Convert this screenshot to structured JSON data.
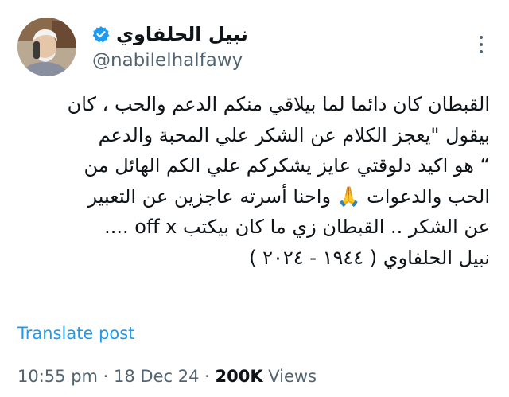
{
  "author": {
    "display_name": "نبيل الحلفاوي",
    "handle": "@nabilelhalfawy",
    "verified": true,
    "avatar_icon": "profile-photo"
  },
  "post": {
    "lines": [
      "القبطان كان دائما لما بيلاقي منكم الدعم والحب ، كان",
      "بيقول \"يعجز الكلام عن الشكر علي المحبة والدعم",
      "“ هو اكيد دلوقتي عايز يشكركم علي الكم الهائل من",
      "الحب والدعوات 🙏 واحنا أسرته عاجزين عن التعبير",
      "عن الشكر .. القبطان زي ما كان بيكتب off x ....",
      "نبيل الحلفاوي ( ١٩٤٤ - ٢٠٢٤ )"
    ]
  },
  "translate_label": "Translate post",
  "meta": {
    "time": "10:55 pm",
    "separator": " · ",
    "date": "18 Dec 24",
    "views_count": "200K",
    "views_label": " Views"
  },
  "colors": {
    "text": "#0f1419",
    "secondary": "#536471",
    "accent": "#1d9bf0"
  },
  "icons": {
    "verified": "verified-badge-icon",
    "more": "more-options-icon"
  }
}
